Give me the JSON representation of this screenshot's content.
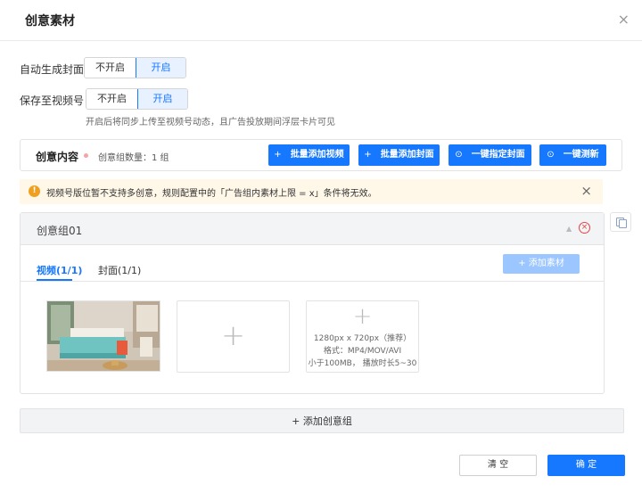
{
  "dialog": {
    "title": "创意素材",
    "close_glyph": "×"
  },
  "auto_cover": {
    "label": "自动生成封面",
    "options": [
      "不开启",
      "开启"
    ],
    "selected": "开启"
  },
  "save_channels": {
    "label": "保存至视频号",
    "options": [
      "不开启",
      "开启"
    ],
    "selected": "开启"
  },
  "hint": "开启后将同步上传至视频号动态，且广告投放期间浮层卡片可见",
  "content": {
    "title": "创意内容",
    "required_mark": "•",
    "group_count": "创意组数量：1 组",
    "buttons": [
      {
        "icon": "+",
        "label": "批量添加视频"
      },
      {
        "icon": "+",
        "label": "批量添加封面"
      },
      {
        "icon": "⊙",
        "label": "一键指定封面"
      },
      {
        "icon": "⊙",
        "label": "一键测新"
      }
    ]
  },
  "warning": {
    "icon": "!",
    "text": "视频号版位暂不支持多创意，规则配置中的「广告组内素材上限 = x」条件将无效。",
    "close_glyph": "×"
  },
  "group": {
    "name": "创意组01",
    "caret": "▲",
    "delete_glyph": "×",
    "tabs": [
      {
        "label": "视频(1/1)",
        "active": true
      },
      {
        "label": "封面(1/1)",
        "active": false
      }
    ],
    "add_material": "+ 添加素材",
    "upload_slot": {
      "plus": "+",
      "size": "1280px x 720px（推荐）",
      "format": "格式：MP4/MOV/AVI",
      "limit": "小于100MB， 播放时长5~30"
    }
  },
  "add_group": "+ 添加创意组",
  "footer": {
    "clear": "清 空",
    "confirm": "确 定"
  },
  "colors": {
    "primary": "#1677ff",
    "warning_bg": "#fff7e8",
    "danger": "#e54545"
  }
}
